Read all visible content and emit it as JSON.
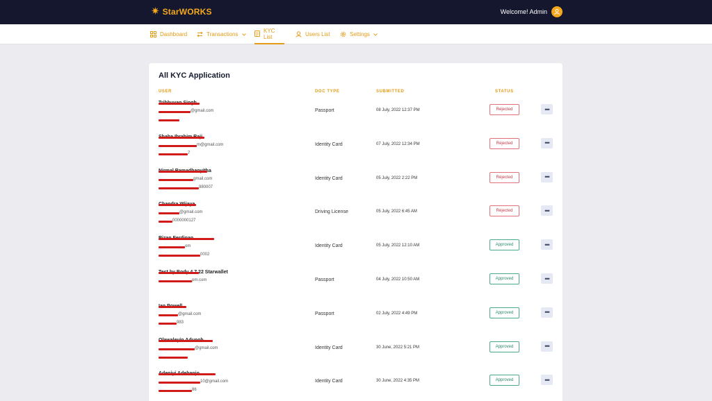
{
  "brand": {
    "name": "StarWORKS",
    "color": "#f5a81c"
  },
  "header": {
    "welcome": "Welcome! Admin"
  },
  "nav": [
    {
      "label": "Dashboard",
      "icon": "dashboard-icon",
      "dropdown": false,
      "active": false
    },
    {
      "label": "Transactions",
      "icon": "transactions-icon",
      "dropdown": true,
      "active": false
    },
    {
      "label": "KYC List",
      "icon": "kyc-list-icon",
      "dropdown": false,
      "active": true
    },
    {
      "label": "Users List",
      "icon": "users-list-icon",
      "dropdown": false,
      "active": false
    },
    {
      "label": "Settings",
      "icon": "settings-icon",
      "dropdown": true,
      "active": false
    }
  ],
  "table": {
    "title": "All KYC Application",
    "headers": {
      "user": "USER",
      "doc_type": "DOC TYPE",
      "submitted": "SUBMITTED",
      "status": "STATUS"
    },
    "rows": [
      {
        "name": "Tribhuvan Singh",
        "email": "@gmail.com",
        "phone": "",
        "doc_type": "Passport",
        "submitted": "08 July, 2022 12:37 PM",
        "status": "Rejected"
      },
      {
        "name": "Shaha Ibrahim Raji",
        "email": "m@gmail.com",
        "phone": "7",
        "doc_type": "Identity Card",
        "submitted": "07 July, 2022 12:34 PM",
        "status": "Rejected"
      },
      {
        "name": "Nirmal Ramadhanyitha",
        "email": "gmail.com",
        "phone": "980007",
        "doc_type": "Identity Card",
        "submitted": "05 July, 2022 2:22 PM",
        "status": "Rejected"
      },
      {
        "name": "Chandra Wijaya",
        "email": "@gmail.com",
        "phone": "0000000127",
        "doc_type": "Driving License",
        "submitted": "05 July, 2022 6:45 AM",
        "status": "Rejected"
      },
      {
        "name": "Rizan Ferdinan",
        "email": "om",
        "phone": "0002",
        "doc_type": "Identity Card",
        "submitted": "05 July, 2022 12:10 AM",
        "status": "Approved"
      },
      {
        "name": "Test by Body 4.7.22 Starwallet",
        "email": "pm.com",
        "phone": "",
        "doc_type": "Passport",
        "submitted": "04 July, 2022 10:50 AM",
        "status": "Approved"
      },
      {
        "name": "Ian Powell",
        "email": "@gmail.com",
        "phone": "983",
        "doc_type": "Passport",
        "submitted": "02 July, 2022 4:49 PM",
        "status": "Approved"
      },
      {
        "name": "Olawaleyin Adunoh",
        "email": "@gmail.com",
        "phone": "",
        "doc_type": "Identity Card",
        "submitted": "30 June, 2022 5:21 PM",
        "status": "Approved"
      },
      {
        "name": "Adeniyi Adebanjo",
        "email": "10@gmail.com",
        "phone": "86",
        "doc_type": "Identity Card",
        "submitted": "30 June, 2022 4:35 PM",
        "status": "Approved"
      }
    ]
  },
  "colors": {
    "accent": "#e39b15",
    "topbar": "#15172f",
    "rejected": "#c93a48",
    "approved": "#2d8a70"
  }
}
